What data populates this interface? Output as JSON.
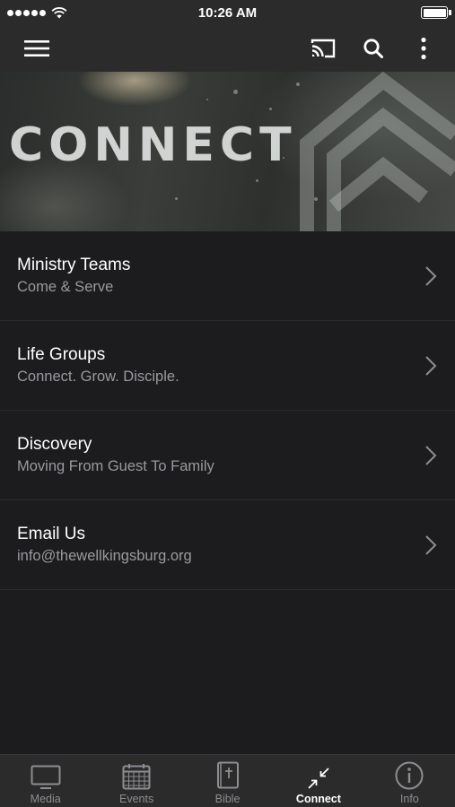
{
  "status_bar": {
    "time": "10:26 AM"
  },
  "app_bar": {
    "menu_icon": "hamburger-menu-icon",
    "cast_icon": "cast-icon",
    "search_icon": "search-icon",
    "more_icon": "more-vertical-icon"
  },
  "banner": {
    "title": "CONNECT"
  },
  "list": {
    "items": [
      {
        "title": "Ministry Teams",
        "subtitle": "Come & Serve"
      },
      {
        "title": "Life Groups",
        "subtitle": "Connect. Grow. Disciple."
      },
      {
        "title": "Discovery",
        "subtitle": "Moving From Guest To Family"
      },
      {
        "title": "Email Us",
        "subtitle": "info@thewellkingsburg.org"
      }
    ]
  },
  "tab_bar": {
    "tabs": [
      {
        "label": "Media",
        "icon": "tv-icon"
      },
      {
        "label": "Events",
        "icon": "calendar-icon"
      },
      {
        "label": "Bible",
        "icon": "bible-icon"
      },
      {
        "label": "Connect",
        "icon": "connect-arrows-icon",
        "active": true
      },
      {
        "label": "Info",
        "icon": "info-icon"
      }
    ]
  },
  "colors": {
    "background": "#1c1c1e",
    "bar": "#2b2b2b",
    "subtitle": "#9a9a9e",
    "inactive_tab": "#8e8e92"
  }
}
